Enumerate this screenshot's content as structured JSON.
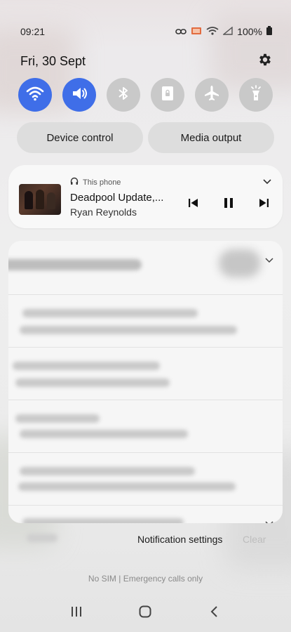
{
  "status_bar": {
    "time": "09:21",
    "battery": "100%",
    "icons": [
      "link-icon",
      "cast-icon",
      "wifi-calling-icon",
      "signal-icon",
      "battery-icon"
    ]
  },
  "header": {
    "date": "Fri, 30 Sept",
    "settings_icon": "gear-icon"
  },
  "quick_settings": [
    {
      "name": "wifi",
      "icon": "wifi-icon",
      "state": "on"
    },
    {
      "name": "sound",
      "icon": "speaker-icon",
      "state": "on"
    },
    {
      "name": "bluetooth",
      "icon": "bluetooth-icon",
      "state": "off"
    },
    {
      "name": "lock-rotation",
      "icon": "lock-screen-icon",
      "state": "off"
    },
    {
      "name": "airplane",
      "icon": "airplane-icon",
      "state": "off"
    },
    {
      "name": "flashlight",
      "icon": "flashlight-icon",
      "state": "off"
    }
  ],
  "pills": {
    "device_control": "Device control",
    "media_output": "Media output"
  },
  "media": {
    "source": "This phone",
    "title": "Deadpool Update,...",
    "artist": "Ryan Reynolds"
  },
  "footer": {
    "notification_settings": "Notification settings",
    "clear": "Clear",
    "no_sim": "No SIM | Emergency calls only"
  },
  "colors": {
    "accent": "#3f6ee8",
    "tile_off": "#c9c9c9",
    "pill_bg": "#dddddd"
  }
}
